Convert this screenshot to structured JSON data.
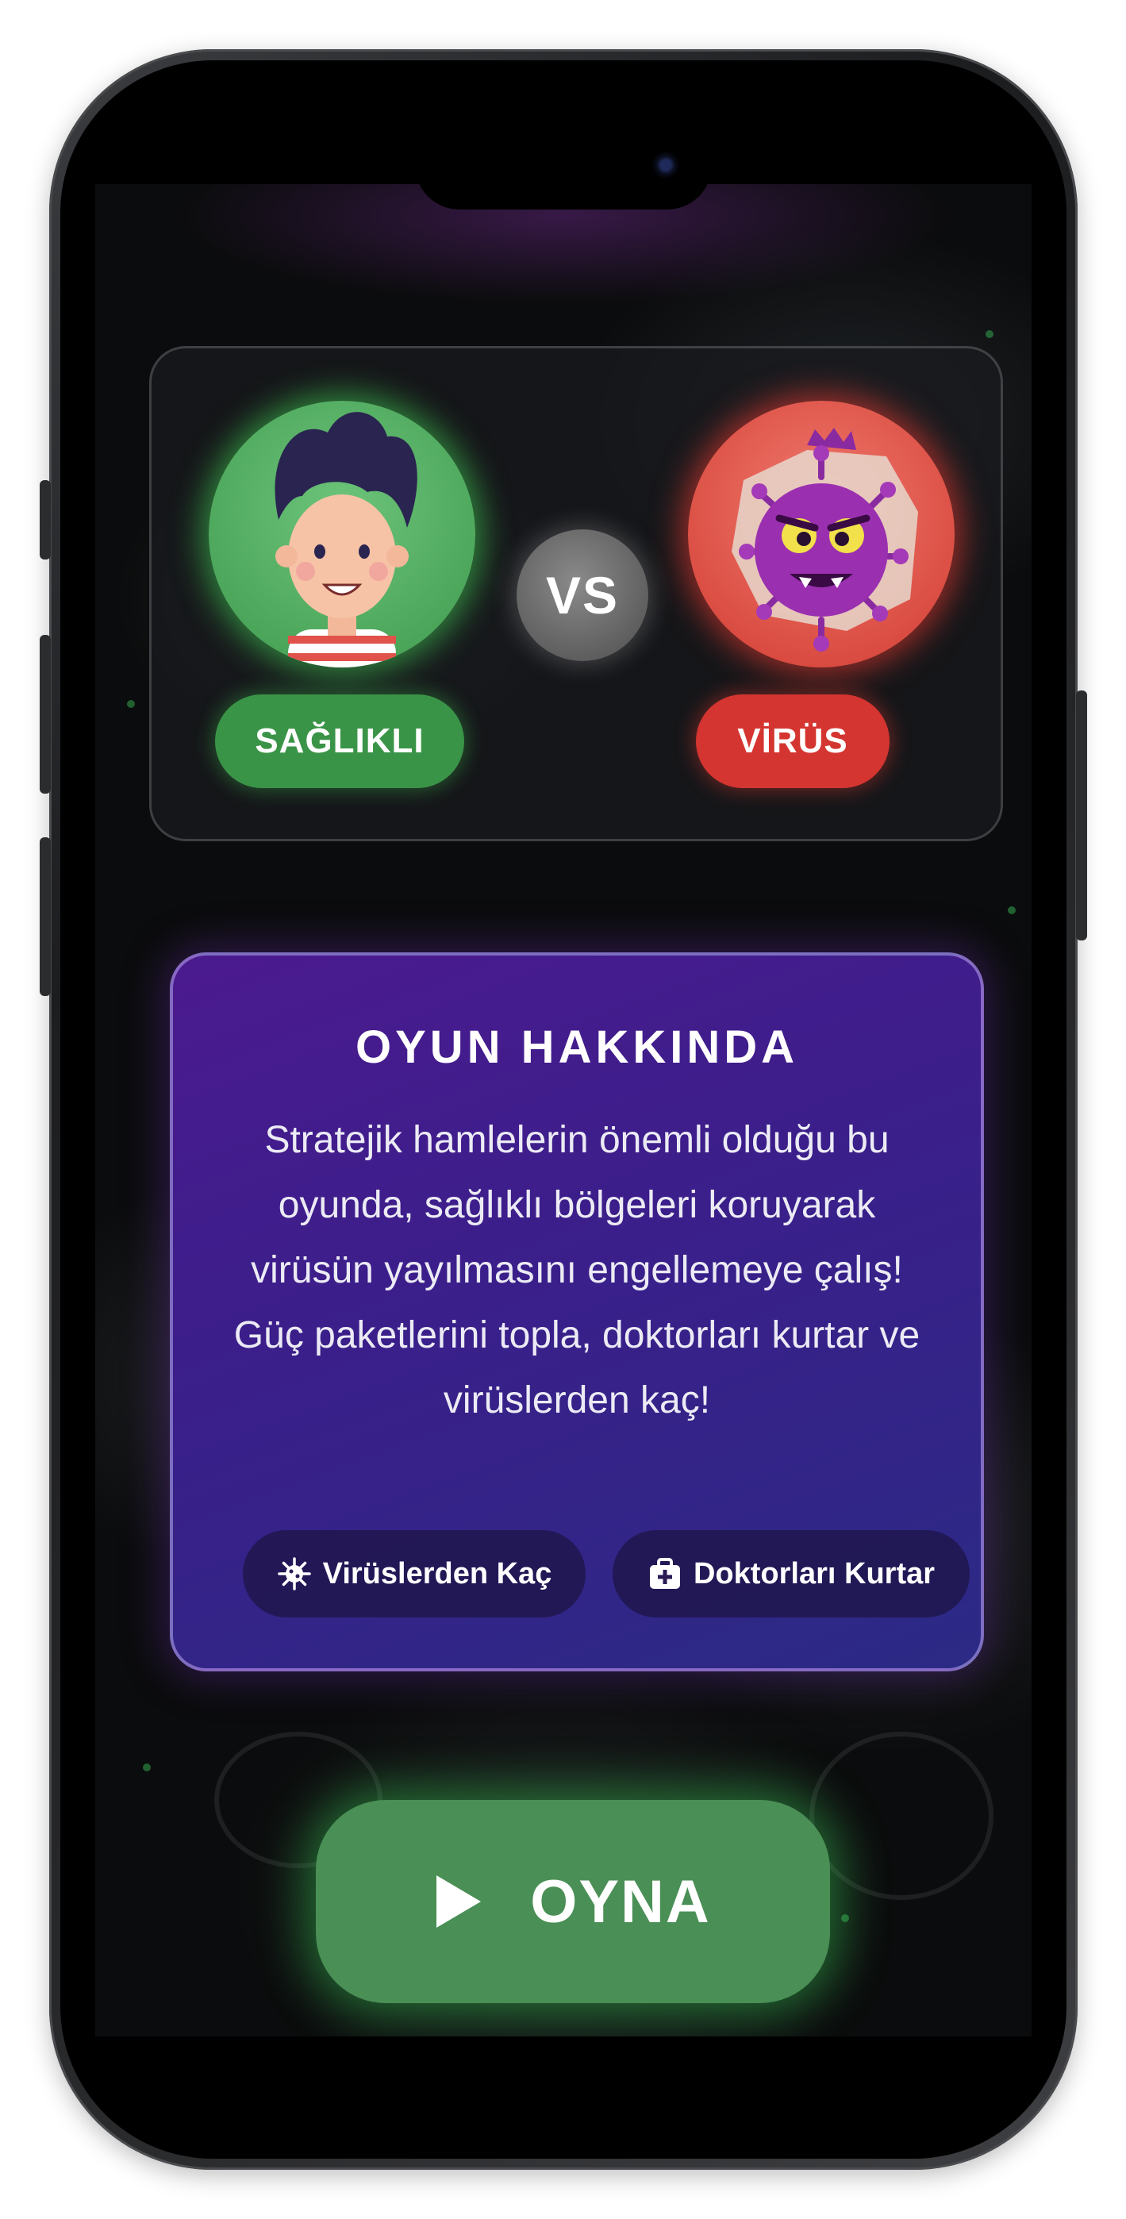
{
  "versus": {
    "healthy_label": "SAĞLIKLI",
    "vs_label": "VS",
    "virus_label": "VİRÜS"
  },
  "about": {
    "title": "OYUN HAKKINDA",
    "description": "Stratejik hamlelerin önemli olduğu bu oyunda, sağlıklı bölgeleri koruyarak virüsün yayılmasını engellemeye çalış! Güç paketlerini topla, doktorları kurtar ve virüslerden kaç!",
    "features": [
      {
        "icon": "virus-icon",
        "label": "Virüslerden Kaç"
      },
      {
        "icon": "medkit-icon",
        "label": "Doktorları Kurtar"
      }
    ]
  },
  "play_button": {
    "icon": "play-icon",
    "label": "OYNA"
  },
  "colors": {
    "healthy": "#3a9447",
    "virus": "#d43531",
    "about_card": "#3a1f8a",
    "play": "#4a8f55"
  }
}
